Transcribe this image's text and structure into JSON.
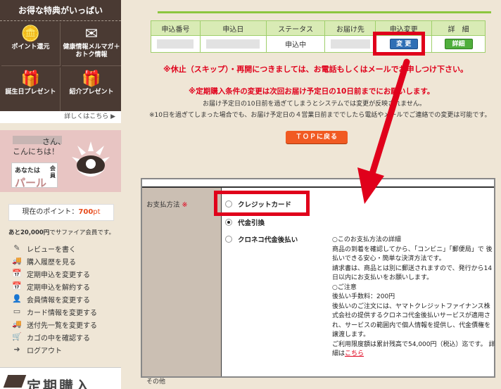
{
  "sidebar": {
    "benefits": {
      "title": "お得な特典がいっぱい",
      "items": [
        {
          "icon": "coins-icon",
          "glyph": "🪙",
          "label": "ポイント還元"
        },
        {
          "icon": "mail-icon",
          "glyph": "✉",
          "label": "健康情報メルマガ＋おトク情報"
        },
        {
          "icon": "gift-icon",
          "glyph": "🎁",
          "label": "誕生日プレゼント"
        },
        {
          "icon": "present-icon",
          "glyph": "🎁",
          "label": "紹介プレゼント"
        }
      ],
      "more_link": "詳しくはこちら ▶"
    },
    "member": {
      "greeting_suffix": "さん、",
      "greeting_line2": "こんにちは！",
      "rank_prefix": "あなたは",
      "rank_name": "パール",
      "rank_suffix": "会員"
    },
    "points": {
      "label": "現在のポイント：",
      "value": "700",
      "unit": "pt"
    },
    "sapphire_note": {
      "amount": "あと20,000円",
      "text": "でサファイア会員です。"
    },
    "menu": [
      {
        "icon": "pencil-icon",
        "glyph": "✎",
        "label": "レビューを書く"
      },
      {
        "icon": "truck-icon",
        "glyph": "🚚",
        "label": "購入履歴を見る"
      },
      {
        "icon": "calendar-icon",
        "glyph": "📅",
        "label": "定期申込を変更する"
      },
      {
        "icon": "calendar-cancel-icon",
        "glyph": "📅",
        "label": "定期申込を解約する"
      },
      {
        "icon": "user-icon",
        "glyph": "👤",
        "label": "会員情報を変更する"
      },
      {
        "icon": "card-icon",
        "glyph": "▭",
        "label": "カード情報を変更する"
      },
      {
        "icon": "truck-list-icon",
        "glyph": "🚚",
        "label": "送付先一覧を変更する"
      },
      {
        "icon": "cart-icon",
        "glyph": "🛒",
        "label": "カゴの中を確認する"
      },
      {
        "icon": "logout-icon",
        "glyph": "➜",
        "label": "ログアウト"
      }
    ],
    "bottom_promo": "定期購入"
  },
  "order_table": {
    "headers": [
      "申込番号",
      "申込日",
      "ステータス",
      "お届け先",
      "申込変更",
      "詳　細"
    ],
    "row": {
      "status": "申込中",
      "change_button": "変 更",
      "detail_button": "詳細"
    }
  },
  "notices": {
    "line1": "※休止（スキップ）・再開につきましては、お電話もしくはメールでお申しつけ下さい。",
    "line2": "※定期購入条件の変更は次回お届け予定日の10日前までにお願いします。",
    "line3": "お届け予定日の10日前を過ぎてしまうとシステムでは変更が反映されません。",
    "line4": "※10日を過ぎてしまった場合でも、お届け予定日の４営業日前まででしたら電話やメールでご連絡での変更は可能です。"
  },
  "top_button": "ＴＯＰに戻る",
  "payment": {
    "label": "お支払方法",
    "required_mark": "※",
    "other_label": "その他",
    "options": [
      {
        "label": "クレジットカード",
        "selected": false
      },
      {
        "label": "代金引換",
        "selected": true
      },
      {
        "label": "クロネコ代金後払い",
        "selected": false
      }
    ],
    "description": [
      "○このお支払方法の詳細",
      "商品の到着を確認してから、「コンビニ」「郵便局」で 後払いできる安心・簡単な決済方法です。",
      "請求書は、商品とは別に郵送されますので、発行から14日以内にお支払いをお願いします。",
      "○ご注意",
      "後払い手数料：200円",
      "後払いのご注文には、ヤマトクレジットファイナンス株式会社の提供するクロネコ代金後払いサービスが適用され、サービスの範囲内で個人情報を提供し、代金債権を譲渡します。",
      "ご利用限度額は累計残高で54,000円（税込）迄です。 詳細は"
    ],
    "description_link": "こちら"
  },
  "colors": {
    "accent_red": "#e0001b",
    "green": "#8cc63f",
    "sidebar_dark": "#4a3a33",
    "pink": "#e8c5c3",
    "orange": "#f15a22"
  }
}
